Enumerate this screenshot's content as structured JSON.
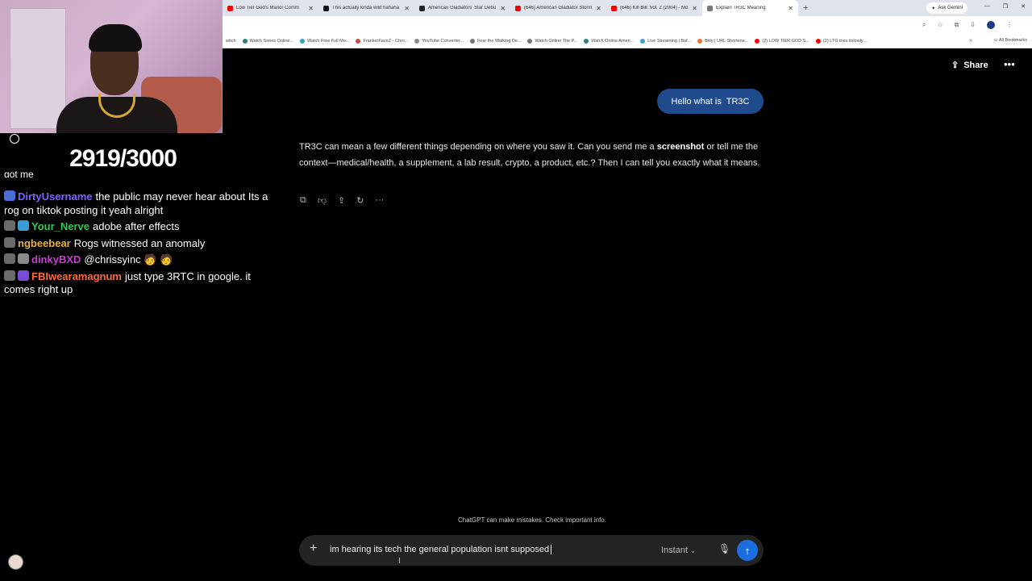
{
  "browser": {
    "tabs": [
      {
        "label": "Low Tier God's Manor Comm",
        "color": "#ff0000"
      },
      {
        "label": "This actually kinda wild hahaha",
        "color": "#111111"
      },
      {
        "label": "American Gladiators' Star Debu",
        "color": "#222222"
      },
      {
        "label": "(646) American Gladiator Storm",
        "color": "#ff0000"
      },
      {
        "label": "(646) Kill Bill: Vol. 2 (2004) - Mo",
        "color": "#ff0000"
      },
      {
        "label": "Explain TR3C Meaning",
        "color": "#777777",
        "active": true
      }
    ],
    "ask_gemini": "Ask Gemini",
    "bookmarks": [
      "witch",
      "Watch Series Online...",
      "Watch Free Full Mo...",
      "FrankerFaceZ - Chro...",
      "YouTube Converter...",
      "Fear the Walking De...",
      "Watch Online The P...",
      "Watch Online Ameri...",
      "Live Streaming | Buf...",
      "Bitly | URL Shortene...",
      "(2) LOW TIER GOD S...",
      "(2) LTG tries itslowly..."
    ],
    "all_bookmarks": "All Bookmarks"
  },
  "chatgpt": {
    "share_label": "Share",
    "user_message": "Hello what is  TR3C",
    "assistant_message": {
      "part1": "TR3C can mean a few different things depending on where you saw it. Can you send me a ",
      "bold1": "screenshot",
      "part2": " or tell me the context—medical/health, a supplement, a lab result, crypto, a product, etc.? Then I can tell you exactly what it means."
    },
    "disclaimer": "ChatGPT can make mistakes. Check important info.",
    "composer_text": "im hearing its tech the general population isnt supposed",
    "model_label": "Instant"
  },
  "overlay": {
    "counter": "2919/3000",
    "chat_cut_text": "got me",
    "chat": [
      {
        "user": "DirtyUsername",
        "color": "#7b61ff",
        "text": "the public may never hear about Its a rog on tiktok posting it yeah alright"
      },
      {
        "user": "Your_Nerve",
        "color": "#34c759",
        "text": "adobe after effects"
      },
      {
        "user": "ngbeebear",
        "color": "#e8b33a",
        "text": "Rogs witnessed an anomaly"
      },
      {
        "user": "dinkyBXD",
        "color": "#c93ed0",
        "text": "@chrissyinc 🧑 🧑"
      },
      {
        "user": "FBIwearamagnum",
        "color": "#ff6a3d",
        "text": "just type 3RTC in google. it comes right up"
      }
    ]
  }
}
